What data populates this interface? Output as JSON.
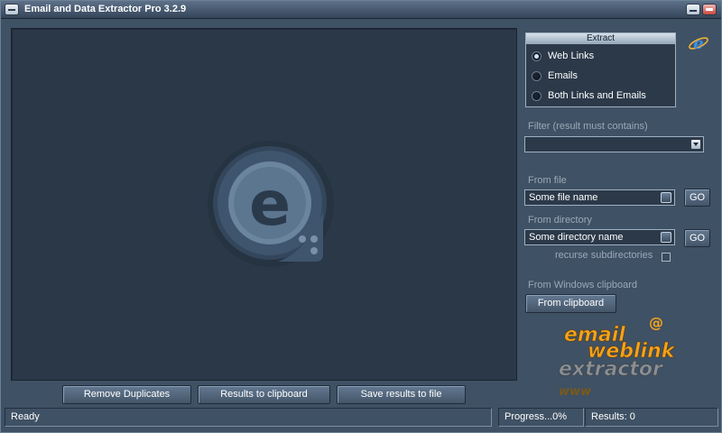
{
  "window": {
    "title": "Email and Data Extractor Pro 3.2.9",
    "icons": {
      "system_menu": "window-menu-icon",
      "minimize": "minimize-icon",
      "close": "close-icon"
    }
  },
  "results_pane": {
    "watermark_icon": "e-logo-icon",
    "watermark_letter": "e"
  },
  "bottom_buttons": {
    "remove_duplicates": "Remove Duplicates",
    "results_to_clipboard": "Results to clipboard",
    "save_results": "Save results to file"
  },
  "extract": {
    "header": "Extract",
    "options": [
      {
        "label": "Web Links",
        "checked": true
      },
      {
        "label": "Emails",
        "checked": false
      },
      {
        "label": "Both Links and Emails",
        "checked": false
      }
    ],
    "corner_icon": "ie-browser-icon",
    "corner_letter": "e"
  },
  "filter": {
    "label": "Filter (result must contains)",
    "value": ""
  },
  "from_file": {
    "label": "From file",
    "value": "Some file name",
    "go": "GO"
  },
  "from_directory": {
    "label": "From directory",
    "value": "Some directory name",
    "go": "GO",
    "recurse_label": "recurse subdirectories",
    "recurse_checked": false
  },
  "clipboard": {
    "label": "From Windows clipboard",
    "button": "From clipboard"
  },
  "brand": {
    "line1": "email",
    "line2": "weblink",
    "line3": "extractor",
    "line4": "www",
    "at": "@"
  },
  "status": {
    "state": "Ready",
    "progress": "Progress...0%",
    "results": "Results: 0"
  },
  "colors": {
    "window_bg": "#3f5164",
    "panel_bg": "#2a3848",
    "brand_orange": "#f4a21c",
    "brand_grey": "#8a8f94"
  }
}
